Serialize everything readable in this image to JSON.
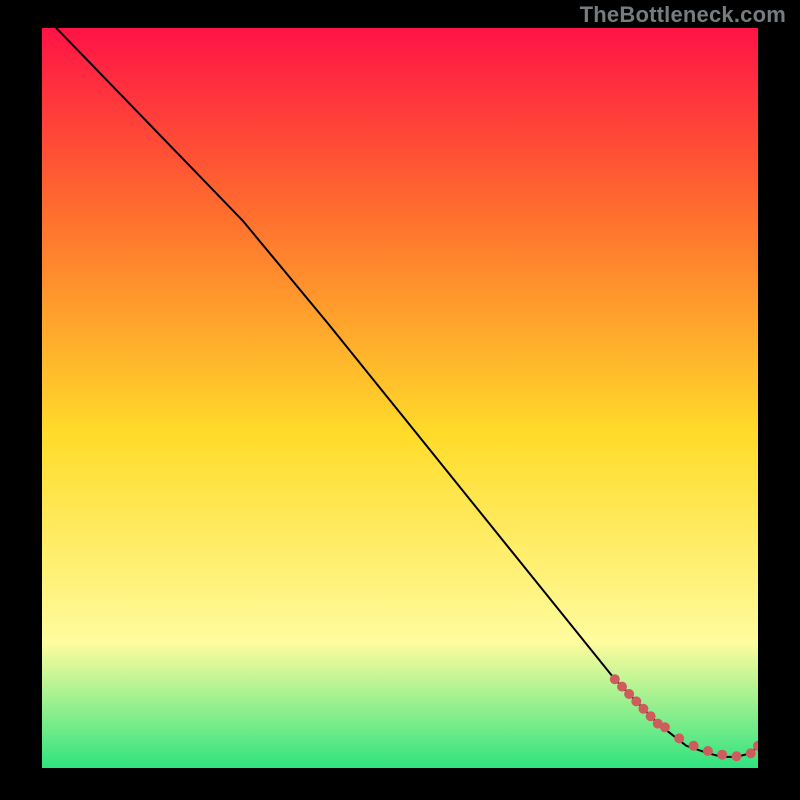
{
  "watermark": "TheBottleneck.com",
  "colors": {
    "gradient_top": "#ff1346",
    "gradient_mid1": "#ff6a2e",
    "gradient_mid2": "#ffdc2a",
    "gradient_mid3": "#fffc9e",
    "gradient_bottom": "#2fe37f",
    "line": "#000000",
    "marker": "#cf5c5c",
    "background": "#000000"
  },
  "chart_data": {
    "type": "line",
    "title": "",
    "xlabel": "",
    "ylabel": "",
    "xlim": [
      0,
      100
    ],
    "ylim": [
      0,
      100
    ],
    "grid": false,
    "legend": false,
    "series": [
      {
        "name": "curve",
        "kind": "line",
        "x": [
          2,
          10,
          20,
          28,
          40,
          50,
          60,
          70,
          80,
          86,
          90,
          93,
          95,
          97,
          99,
          100
        ],
        "y": [
          100,
          92,
          82,
          74,
          60,
          48,
          36,
          24,
          12,
          6,
          3,
          2,
          1.5,
          1.5,
          2,
          3
        ]
      },
      {
        "name": "markers",
        "kind": "scatter",
        "x": [
          80,
          81,
          82,
          83,
          84,
          85,
          86,
          87,
          89,
          91,
          93,
          95,
          97,
          99,
          100
        ],
        "y": [
          12,
          11,
          10,
          9,
          8,
          7,
          6,
          5.5,
          4,
          3,
          2.3,
          1.8,
          1.6,
          2,
          3
        ]
      }
    ]
  }
}
